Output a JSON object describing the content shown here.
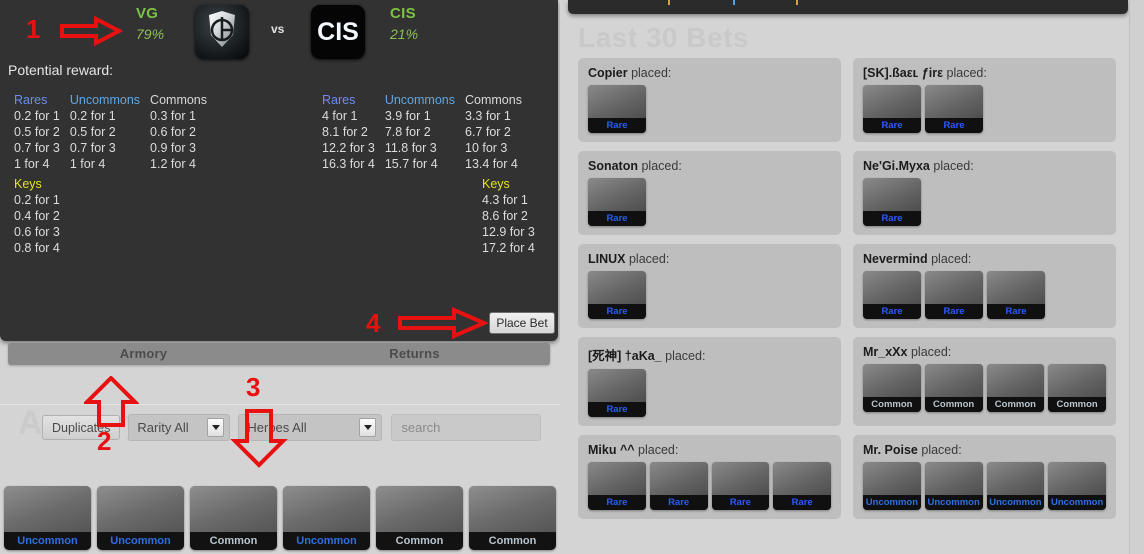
{
  "match": {
    "team_left": {
      "name": "VG",
      "percent": "79%",
      "logo": "vici-gaming-logo"
    },
    "vs_label": "vs",
    "team_right": {
      "name": "CIS",
      "percent": "21%",
      "logo": "cis-logo"
    }
  },
  "reward": {
    "label": "Potential reward:",
    "left_group": [
      {
        "head": "Rares",
        "rows": [
          "0.2 for 1",
          "0.5 for 2",
          "0.7 for 3",
          "1 for 4"
        ]
      },
      {
        "head": "Uncommons",
        "rows": [
          "0.2 for 1",
          "0.5 for 2",
          "0.7 for 3",
          "1 for 4"
        ]
      },
      {
        "head": "Commons",
        "rows": [
          "0.3 for 1",
          "0.6 for 2",
          "0.9 for 3",
          "1.2 for 4"
        ]
      }
    ],
    "right_group": [
      {
        "head": "Rares",
        "rows": [
          "4 for 1",
          "8.1 for 2",
          "12.2 for 3",
          "16.3 for 4"
        ]
      },
      {
        "head": "Uncommons",
        "rows": [
          "3.9 for 1",
          "7.8 for 2",
          "11.8 for 3",
          "15.7 for 4"
        ]
      },
      {
        "head": "Commons",
        "rows": [
          "3.3 for 1",
          "6.7 for 2",
          "10 for 3",
          "13.4 for 4"
        ]
      }
    ],
    "keys_left": {
      "head": "Keys",
      "rows": [
        "0.2 for 1",
        "0.4 for 2",
        "0.6 for 3",
        "0.8 for 4"
      ]
    },
    "keys_right": {
      "head": "Keys",
      "rows": [
        "4.3 for 1",
        "8.6 for 2",
        "12.9 for 3",
        "17.2 for 4"
      ]
    }
  },
  "place_bet_label": "Place Bet",
  "tabs": [
    {
      "label": "Armory"
    },
    {
      "label": "Returns"
    }
  ],
  "armory": {
    "watermark": "Armory",
    "duplicates_label": "Duplicates",
    "rarity_value": "Rarity All",
    "heroes_value": "Heroes All",
    "search_placeholder": "search",
    "inventory": [
      {
        "rarity": "Uncommon",
        "art": "cape-item"
      },
      {
        "rarity": "Uncommon",
        "art": "gauntlet-item"
      },
      {
        "rarity": "Common",
        "art": "curved-sword-item"
      },
      {
        "rarity": "Uncommon",
        "art": "red-banner-item"
      },
      {
        "rarity": "Common",
        "art": "pickaxe-item"
      },
      {
        "rarity": "Common",
        "art": "shoulder-armor-item"
      }
    ]
  },
  "bets": {
    "title": "Last 30 Bets",
    "placed_suffix": "placed:",
    "cards": [
      {
        "player": "Copier",
        "items": [
          {
            "rarity": "Rare"
          }
        ]
      },
      {
        "player": "[SK].ßaεʟ ƒirε",
        "items": [
          {
            "rarity": "Rare"
          },
          {
            "rarity": "Rare"
          }
        ]
      },
      {
        "player": "Sonaton",
        "items": [
          {
            "rarity": "Rare"
          }
        ]
      },
      {
        "player": "Ne'Gi.Myxa",
        "items": [
          {
            "rarity": "Rare"
          }
        ]
      },
      {
        "player": "LINUX",
        "items": [
          {
            "rarity": "Rare"
          }
        ]
      },
      {
        "player": "Nevermind",
        "items": [
          {
            "rarity": "Rare"
          },
          {
            "rarity": "Rare"
          },
          {
            "rarity": "Rare"
          }
        ]
      },
      {
        "player": "[死神] †aKa_",
        "items": [
          {
            "rarity": "Rare"
          }
        ]
      },
      {
        "player": "Mr_xXx",
        "items": [
          {
            "rarity": "Common"
          },
          {
            "rarity": "Common"
          },
          {
            "rarity": "Common"
          },
          {
            "rarity": "Common"
          }
        ]
      },
      {
        "player": "Miku ^^",
        "items": [
          {
            "rarity": "Rare"
          },
          {
            "rarity": "Rare"
          },
          {
            "rarity": "Rare"
          },
          {
            "rarity": "Rare"
          }
        ]
      },
      {
        "player": "Mr. Poise",
        "items": [
          {
            "rarity": "Uncommon"
          },
          {
            "rarity": "Uncommon"
          },
          {
            "rarity": "Uncommon"
          },
          {
            "rarity": "Uncommon"
          }
        ]
      }
    ]
  },
  "annotations": [
    {
      "number": "1",
      "target": "match-odds-row"
    },
    {
      "number": "2",
      "target": "duplicates-button"
    },
    {
      "number": "3",
      "target": "heroes-select"
    },
    {
      "number": "4",
      "target": "place-bet-button"
    }
  ],
  "colors": {
    "accent_green": "#7cc242",
    "rares": "#6a8df0",
    "uncommons": "#61a6e0",
    "commons": "#d8d8d8",
    "keys": "#e3e21c",
    "annotation_red": "#e81111"
  }
}
